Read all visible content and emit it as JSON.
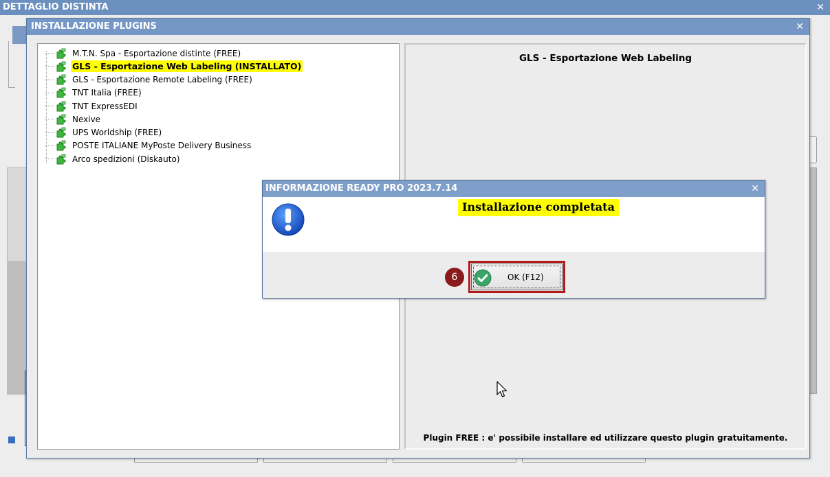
{
  "outer_window": {
    "title": "DETTAGLIO DISTINTA",
    "close": "✕"
  },
  "plugins_window": {
    "title": "INSTALLAZIONE PLUGINS",
    "close": "✕",
    "plugins": [
      {
        "label": "M.T.N. Spa - Esportazione distinte (FREE)",
        "selected": false
      },
      {
        "label": "GLS - Esportazione Web Labeling (INSTALLATO)",
        "selected": true
      },
      {
        "label": "GLS - Esportazione Remote Labeling (FREE)",
        "selected": false
      },
      {
        "label": "TNT Italia (FREE)",
        "selected": false
      },
      {
        "label": "TNT ExpressEDI",
        "selected": false
      },
      {
        "label": "Nexive",
        "selected": false
      },
      {
        "label": "UPS Worldship (FREE)",
        "selected": false
      },
      {
        "label": "POSTE ITALIANE MyPoste Delivery Business",
        "selected": false
      },
      {
        "label": "Arco spedizioni (Diskauto)",
        "selected": false
      }
    ],
    "detail_title": "GLS - Esportazione Web Labeling",
    "detail_footer": "Plugin FREE : e' possibile installare ed utilizzare questo plugin gratuitamente."
  },
  "info_dialog": {
    "title": "INFORMAZIONE READY PRO 2023.7.14",
    "close": "✕",
    "message": "Installazione completata",
    "ok_label": "OK (F12)",
    "step_number": "6"
  },
  "colors": {
    "titlebar": "#7597c6",
    "highlight": "#ffff00",
    "step_badge": "#8b1a1a",
    "ok_frame": "#b31b1b"
  }
}
